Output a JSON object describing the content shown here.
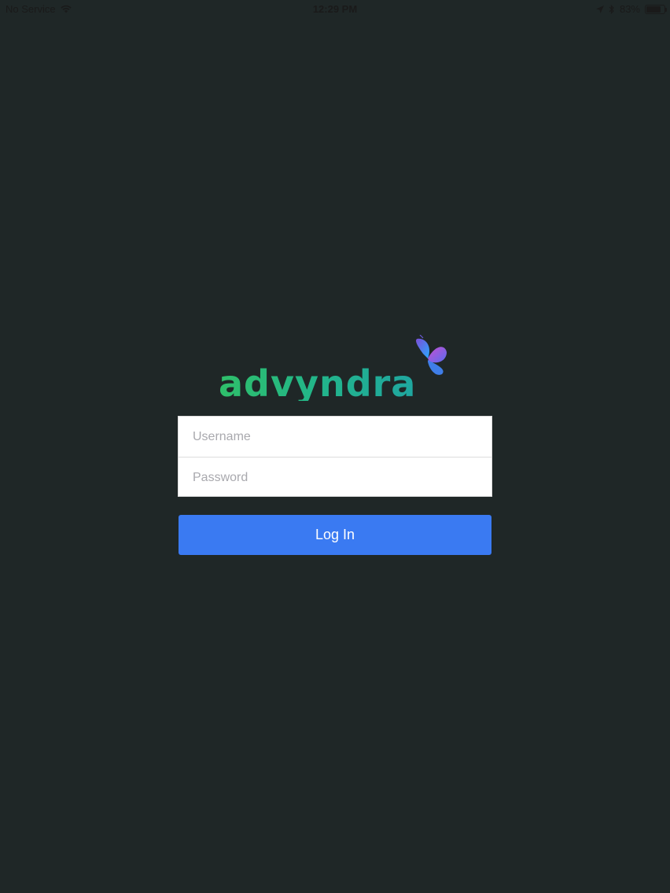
{
  "status_bar": {
    "carrier": "No Service",
    "time": "12:29 PM",
    "battery_percent": "83%",
    "battery_level": 0.83,
    "icons": [
      "wifi-icon",
      "location-arrow-icon",
      "bluetooth-icon",
      "battery-icon"
    ]
  },
  "logo": {
    "text": "advyndra",
    "gradient_start": "#2fbf6a",
    "gradient_end": "#1fa6a0",
    "butterfly_colors": [
      "#7a4fd8",
      "#2aa8ff",
      "#c64fd0"
    ]
  },
  "login_form": {
    "username_placeholder": "Username",
    "password_placeholder": "Password",
    "username_value": "",
    "password_value": ""
  },
  "login_button": {
    "label": "Log In",
    "color": "#3a7af2"
  },
  "colors": {
    "background": "#1f2727"
  }
}
